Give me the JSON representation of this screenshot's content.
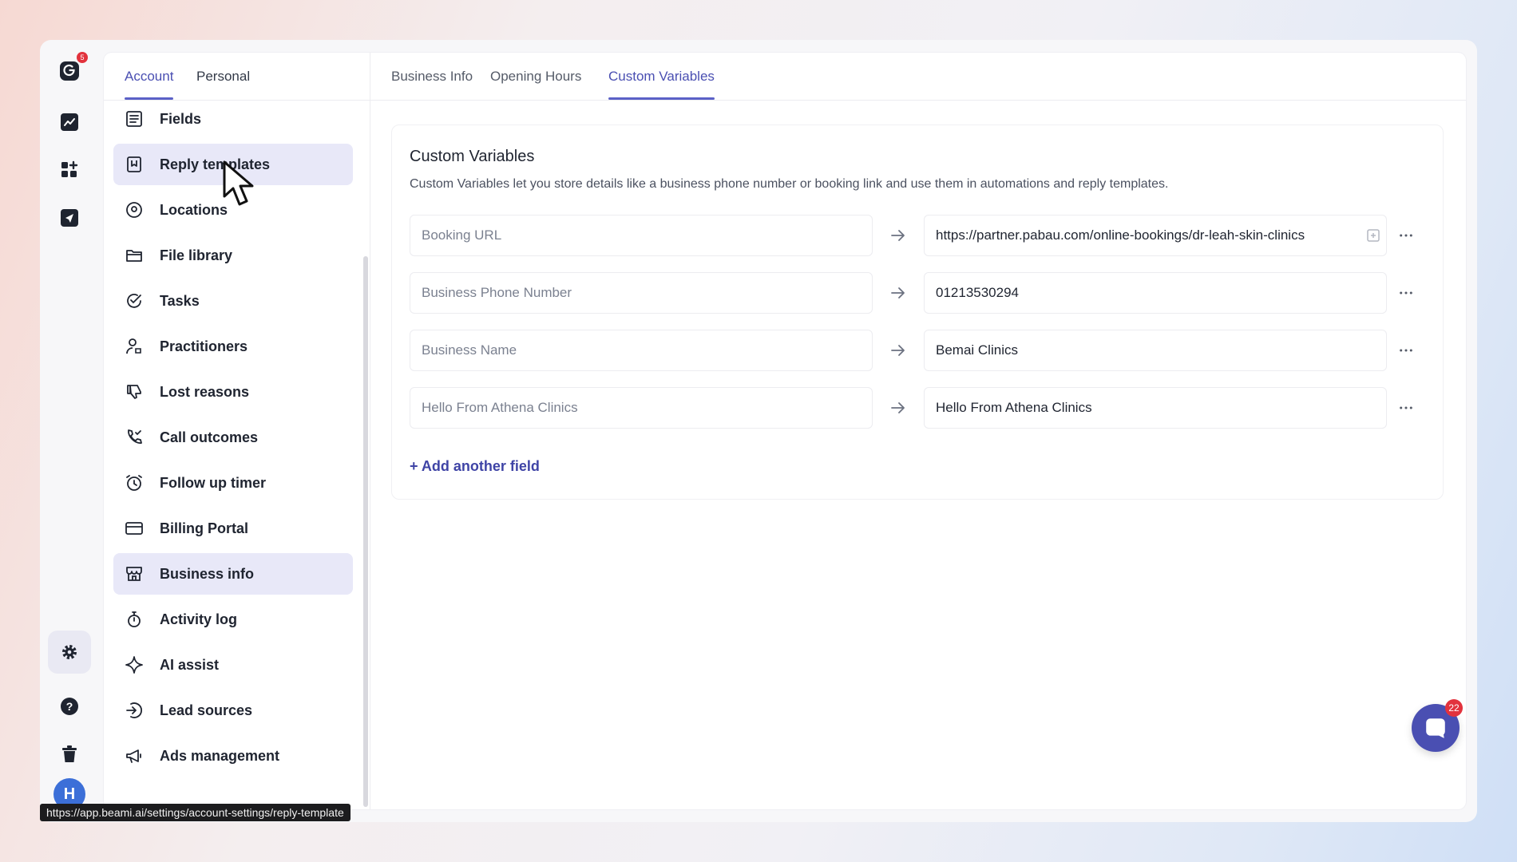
{
  "rail": {
    "notification_count": "5",
    "avatar_initial": "H"
  },
  "settings": {
    "tabs": [
      {
        "label": "Account",
        "active": true
      },
      {
        "label": "Personal",
        "active": false
      }
    ],
    "nav": [
      {
        "label": "Fields",
        "icon": "list-icon"
      },
      {
        "label": "Reply templates",
        "icon": "bookmark-icon"
      },
      {
        "label": "Locations",
        "icon": "location-pin-icon"
      },
      {
        "label": "File library",
        "icon": "folder-icon"
      },
      {
        "label": "Tasks",
        "icon": "check-circle-icon"
      },
      {
        "label": "Practitioners",
        "icon": "user-icon"
      },
      {
        "label": "Lost reasons",
        "icon": "thumbs-down-icon"
      },
      {
        "label": "Call outcomes",
        "icon": "phone-check-icon"
      },
      {
        "label": "Follow up timer",
        "icon": "alarm-icon"
      },
      {
        "label": "Billing Portal",
        "icon": "credit-card-icon"
      },
      {
        "label": "Business info",
        "icon": "store-icon"
      },
      {
        "label": "Activity log",
        "icon": "stopwatch-icon"
      },
      {
        "label": "AI assist",
        "icon": "sparkle-icon"
      },
      {
        "label": "Lead sources",
        "icon": "sign-in-icon"
      },
      {
        "label": "Ads management",
        "icon": "megaphone-icon"
      }
    ]
  },
  "content": {
    "tabs": [
      {
        "label": "Business Info",
        "active": false
      },
      {
        "label": "Opening Hours",
        "active": false
      },
      {
        "label": "Custom Variables",
        "active": true
      }
    ],
    "title": "Custom Variables",
    "description": "Custom Variables let you store details like a business phone number or booking link and use them in automations and reply templates.",
    "variables": [
      {
        "key": "Booking URL",
        "value": "https://partner.pabau.com/online-bookings/dr-leah-skin-clinics"
      },
      {
        "key": "Business Phone Number",
        "value": "01213530294"
      },
      {
        "key": "Business Name",
        "value": "Bemai Clinics"
      },
      {
        "key": "Hello From Athena Clinics",
        "value": "Hello From Athena Clinics"
      }
    ],
    "add_field_label": "+ Add another field"
  },
  "chat": {
    "badge_count": "22"
  },
  "status_url": "https://app.beami.ai/settings/account-settings/reply-template",
  "colors": {
    "accent": "#4a4fb2",
    "active_bg": "#e8e8f8",
    "badge": "#e2323d"
  }
}
